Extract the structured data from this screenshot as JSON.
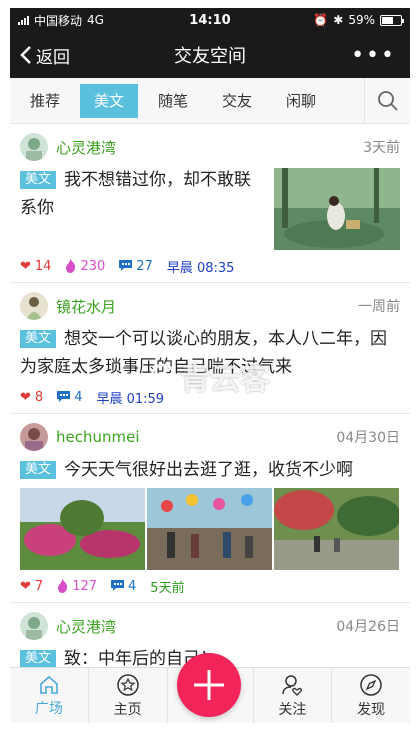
{
  "status_bar": {
    "carrier": "中国移动",
    "network": "4G",
    "time": "14:10",
    "battery_text": "59%",
    "battery_level": 0.59
  },
  "nav": {
    "back_label": "返回",
    "title": "交友空间",
    "more_label": "•••"
  },
  "tabs": [
    {
      "label": "推荐",
      "active": false
    },
    {
      "label": "美文",
      "active": true
    },
    {
      "label": "随笔",
      "active": false
    },
    {
      "label": "交友",
      "active": false
    },
    {
      "label": "闲聊",
      "active": false
    }
  ],
  "posts": [
    {
      "user": "心灵港湾",
      "time": "3天前",
      "badge": "美文",
      "text": "我不想错过你，却不敢联系你",
      "likes": "14",
      "hot": "230",
      "comments": "27",
      "posted": "早晨 08:35"
    },
    {
      "user": "镜花水月",
      "time": "一周前",
      "badge": "美文",
      "text": "想交一个可以谈心的朋友，本人八二年，因为家庭太多琐事压的自己喘不过气来",
      "likes": "8",
      "comments": "4",
      "posted": "早晨 01:59"
    },
    {
      "user": "hechunmei",
      "time": "04月30日",
      "badge": "美文",
      "text": "今天天气很好出去逛了逛，收货不少啊",
      "likes": "7",
      "hot": "127",
      "comments": "4",
      "posted": "5天前"
    },
    {
      "user": "心灵港湾",
      "time": "04月26日",
      "badge": "美文",
      "text": "致：中年后的自己！"
    }
  ],
  "watermark": "青云客",
  "bottom_nav": [
    {
      "label": "广场",
      "icon": "home-icon",
      "active": true
    },
    {
      "label": "主页",
      "icon": "star-icon",
      "active": false
    },
    {
      "label": "关注",
      "icon": "user-heart-icon",
      "active": false
    },
    {
      "label": "发现",
      "icon": "compass-icon",
      "active": false
    }
  ],
  "colors": {
    "accent": "#5bc0de",
    "fab": "#f2245a",
    "username": "#3aa21f",
    "header": "#1a1a1a"
  }
}
